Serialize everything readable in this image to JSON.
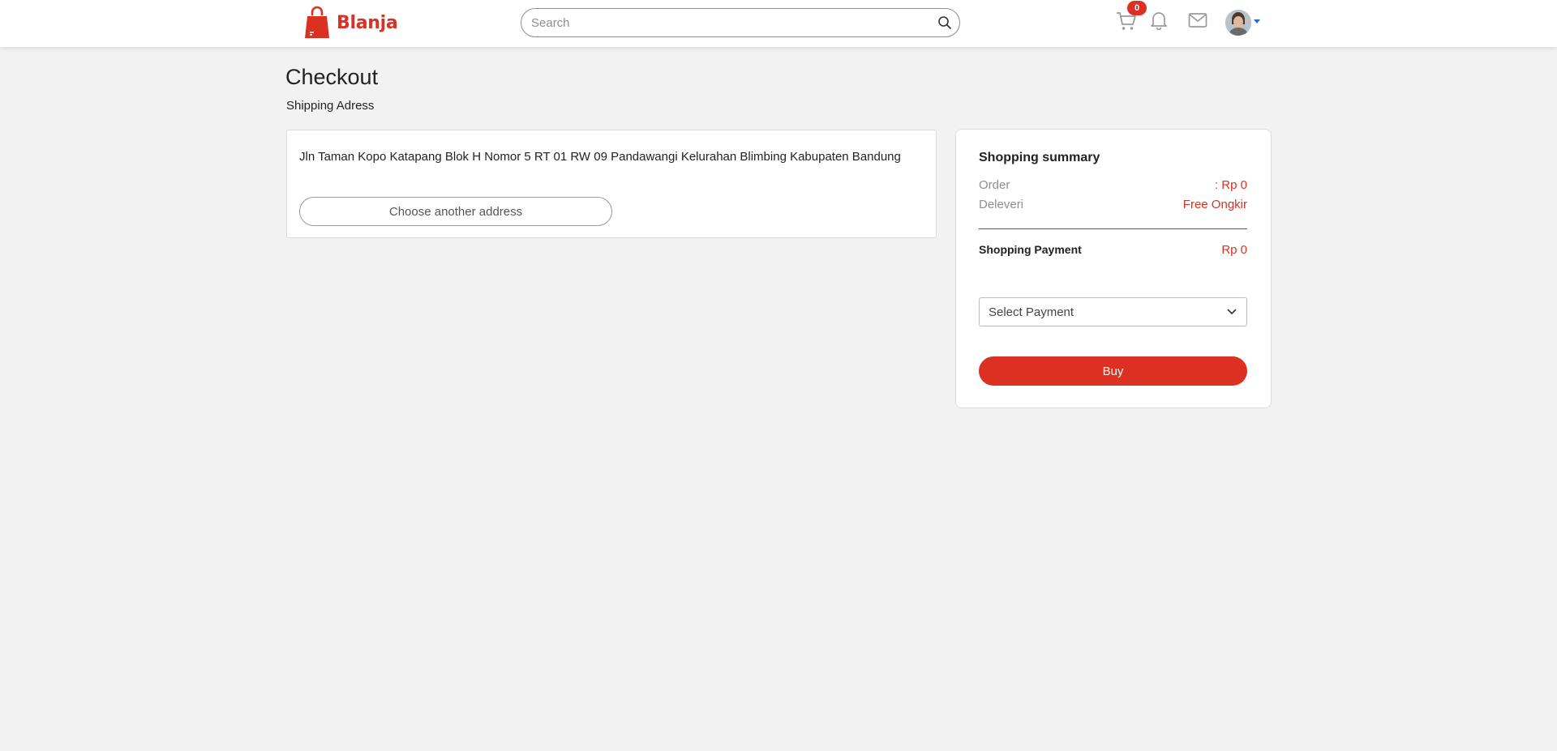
{
  "brand": {
    "name": "Blanja"
  },
  "search": {
    "placeholder": "Search"
  },
  "header": {
    "cart_count": "0"
  },
  "page": {
    "title": "Checkout",
    "section_title": "Shipping Adress"
  },
  "address": {
    "text": "Jln Taman Kopo Katapang Blok H Nomor 5 RT 01 RW 09 Pandawangi Kelurahan Blimbing Kabupaten Bandung",
    "choose_button": "Choose another address"
  },
  "summary": {
    "title": "Shopping summary",
    "order_label": "Order",
    "order_value": ": Rp 0",
    "delivery_label": "Deleveri",
    "delivery_value": "Free Ongkir",
    "payment_label": "Shopping Payment",
    "payment_value": "Rp 0",
    "select_payment": "Select Payment",
    "buy_button": "Buy"
  },
  "colors": {
    "brand": "#db3022",
    "background": "#f2f2f2",
    "caret": "#1f6fe0"
  },
  "icons": [
    "bag-logo-icon",
    "search-icon",
    "cart-icon",
    "bell-icon",
    "mail-icon",
    "chevron-down-icon",
    "caret-down-icon"
  ]
}
